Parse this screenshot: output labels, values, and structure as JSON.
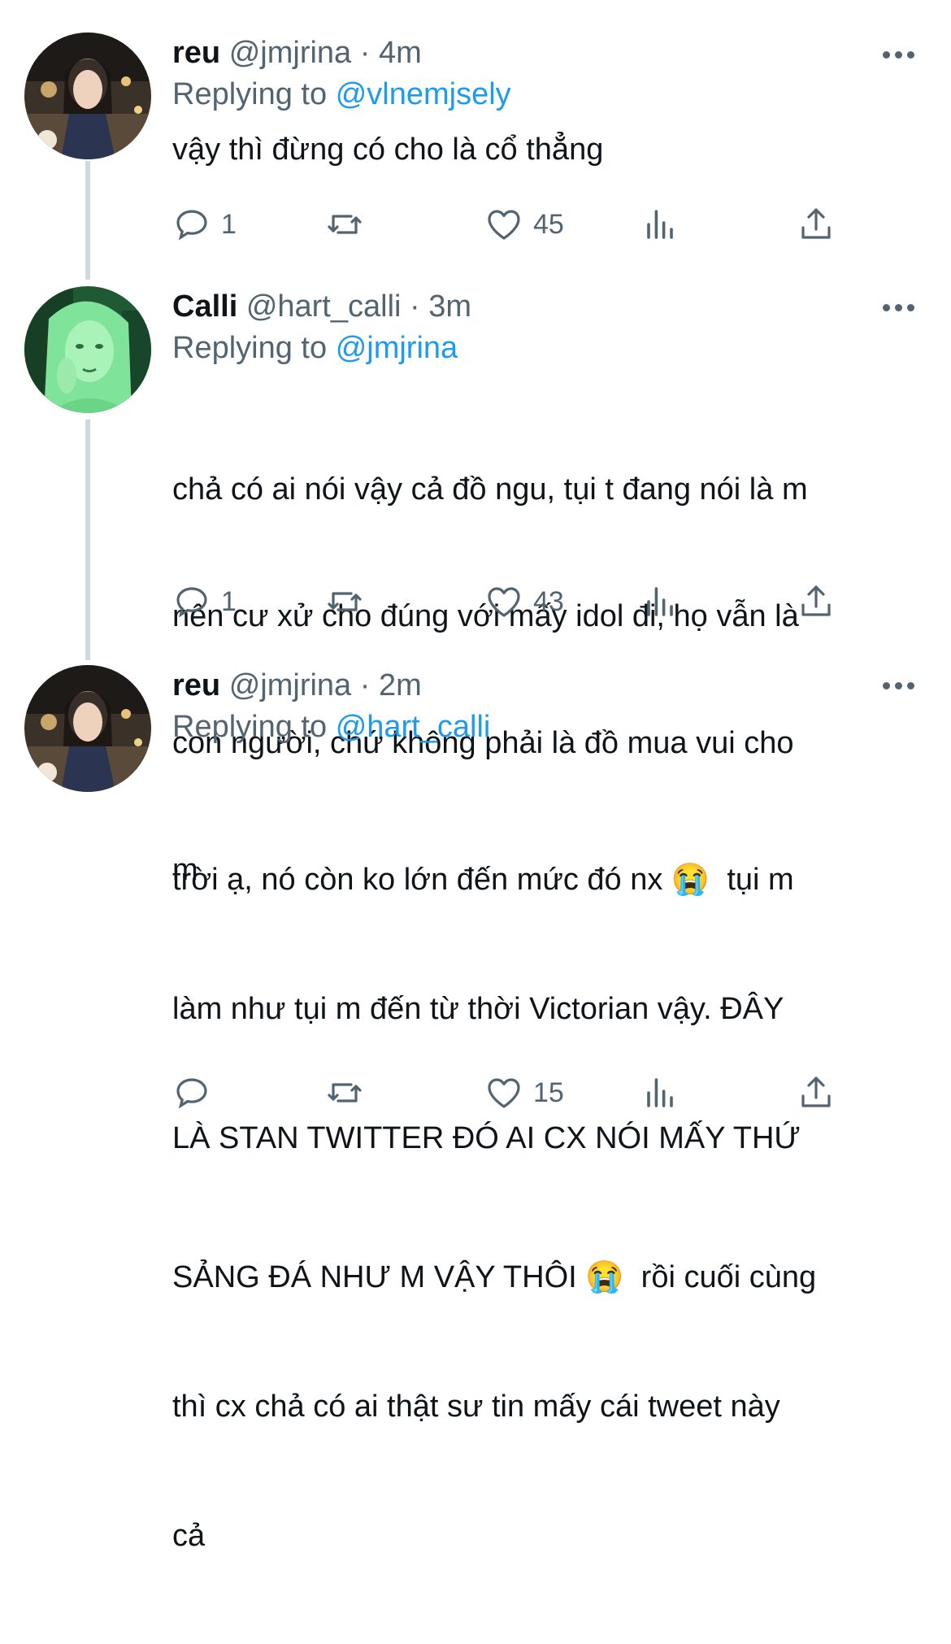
{
  "tweets": [
    {
      "name": "reu",
      "handle": "@jmjrina",
      "separator": "·",
      "time": "4m",
      "replying_label": "Replying to",
      "replying_to": "@vlnemjsely",
      "text": "vậy thì đừng có cho là cổ thẳng",
      "replies": "1",
      "retweets": "",
      "likes": "45"
    },
    {
      "name": "Calli",
      "handle": "@hart_calli",
      "separator": "·",
      "time": "3m",
      "replying_label": "Replying to",
      "replying_to": "@jmjrina",
      "text_lines": [
        "chả có ai nói vậy cả đồ ngu, tụi t đang nói là m",
        "nên cư xử cho đúng với mấy idol đi, họ vẫn là",
        "con người, chứ không phải là đồ mua vui cho",
        "m"
      ],
      "replies": "1",
      "retweets": "",
      "likes": "43"
    },
    {
      "name": "reu",
      "handle": "@jmjrina",
      "separator": "·",
      "time": "2m",
      "replying_label": "Replying to",
      "replying_to": "@hart_calli",
      "text_lines": [
        "trời ạ, nó còn ko lớn đến mức đó nx 😭  tụi m",
        "làm như tụi m đến từ thời Victorian vậy. ĐÂY",
        "LÀ STAN TWITTER ĐÓ AI CX NÓI MẤY THỨ",
        "SẢNG ĐÁ NHƯ M VẬY THÔI 😭  rồi cuối cùng",
        "thì cx chả có ai thật sư tin mấy cái tweet này",
        "cả"
      ],
      "replies": "",
      "retweets": "",
      "likes": "15"
    }
  ],
  "icons": {
    "reply": "speech-bubble-icon",
    "retweet": "retweet-arrows-icon",
    "like": "heart-outline-icon",
    "analytics": "bar-chart-icon",
    "share": "share-upload-icon",
    "more": "three-dots-icon"
  },
  "colors": {
    "text": "#0f1419",
    "muted": "#536471",
    "mention": "#1d9bf0",
    "thread_line": "#cfd9de"
  }
}
